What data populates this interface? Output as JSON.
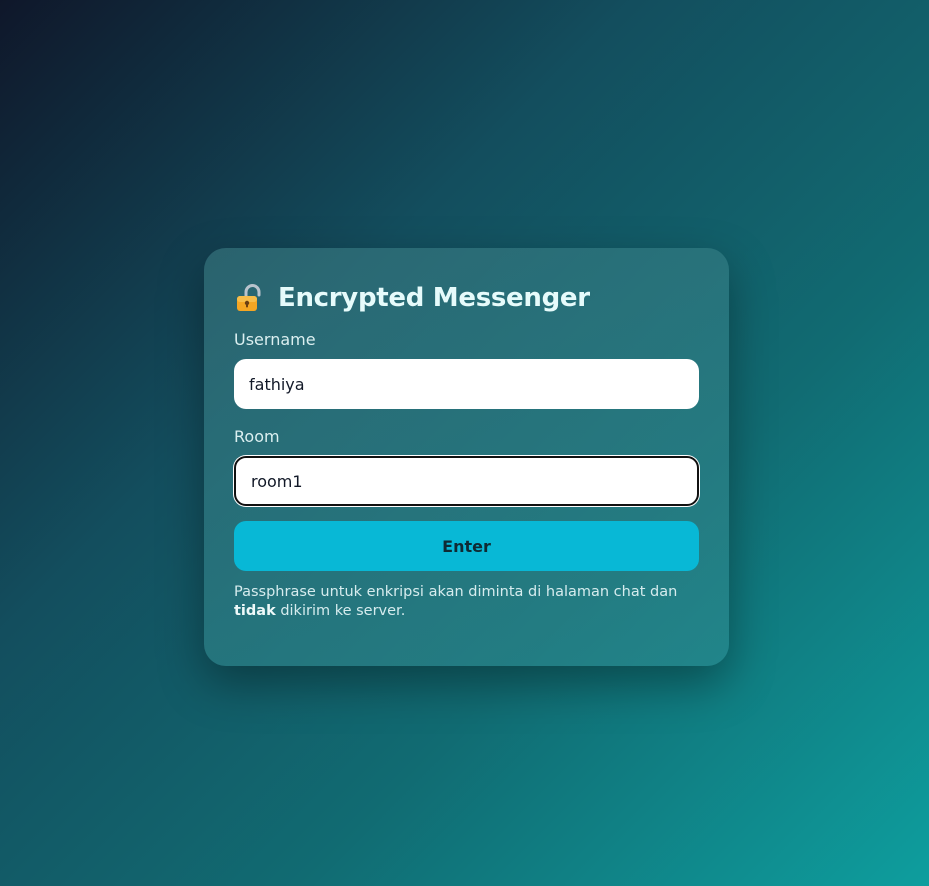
{
  "card": {
    "title": "Encrypted Messenger",
    "icon": "locked-padlock-icon"
  },
  "form": {
    "username": {
      "label": "Username",
      "value": "fathiya"
    },
    "room": {
      "label": "Room",
      "value": "room1"
    },
    "submit_label": "Enter"
  },
  "note": {
    "before": "Passphrase untuk enkripsi akan diminta di halaman chat dan",
    "emphasis": "tidak",
    "after": " dikirim ke server."
  },
  "colors": {
    "accent": "#08b8d6",
    "card_text": "#e6fbfb"
  }
}
